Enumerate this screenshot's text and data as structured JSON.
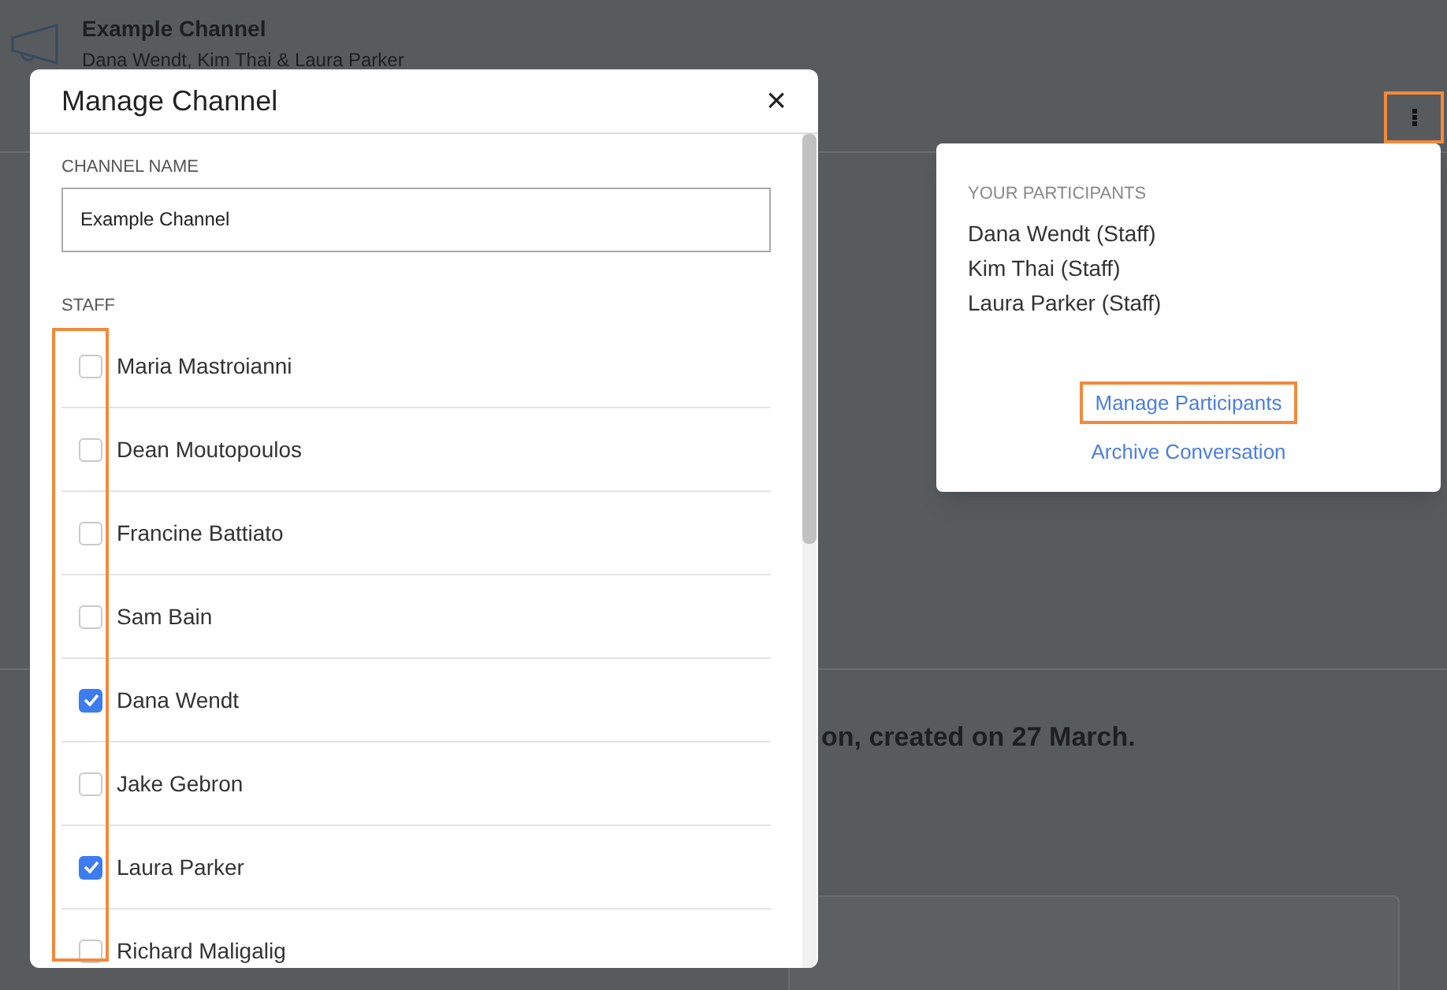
{
  "channel_header": {
    "title": "Example Channel",
    "subtitle": "Dana Wendt, Kim Thai & Laura Parker"
  },
  "background_message": "on, created on 27 March.",
  "modal": {
    "title": "Manage Channel",
    "close": "×",
    "channel_name_label": "CHANNEL NAME",
    "channel_name_value": "Example Channel",
    "staff_label": "STAFF",
    "staff": [
      {
        "name": "Maria Mastroianni",
        "checked": false
      },
      {
        "name": "Dean Moutopoulos",
        "checked": false
      },
      {
        "name": "Francine Battiato",
        "checked": false
      },
      {
        "name": "Sam Bain",
        "checked": false
      },
      {
        "name": "Dana Wendt",
        "checked": true
      },
      {
        "name": "Jake Gebron",
        "checked": false
      },
      {
        "name": "Laura Parker",
        "checked": true
      },
      {
        "name": "Richard Maligalig",
        "checked": false
      }
    ]
  },
  "participants_menu": {
    "heading": "YOUR PARTICIPANTS",
    "participants": [
      "Dana Wendt (Staff)",
      "Kim Thai (Staff)",
      "Laura Parker (Staff)"
    ],
    "actions": [
      "Manage Participants",
      "Archive Conversation"
    ]
  }
}
